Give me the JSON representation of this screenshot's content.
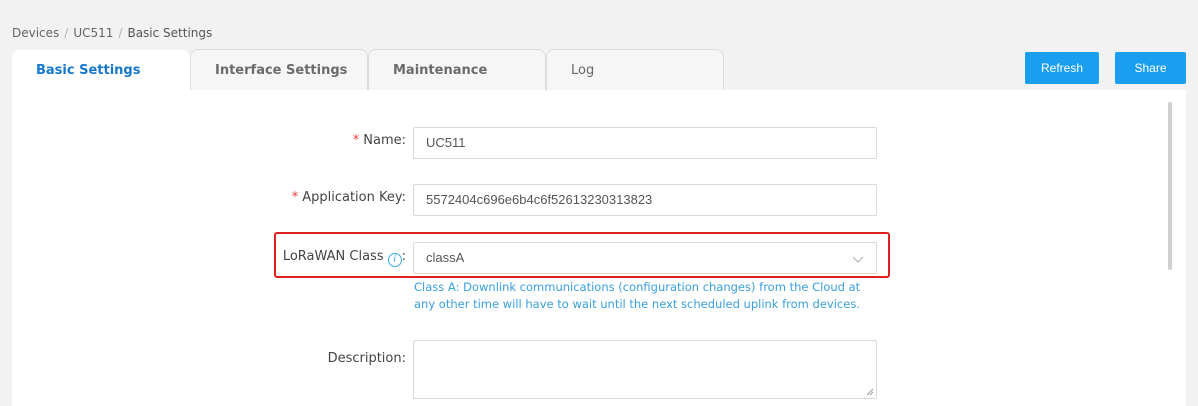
{
  "breadcrumb": {
    "items": [
      "Devices",
      "UC511",
      "Basic Settings"
    ],
    "separator": "/"
  },
  "tabs": [
    {
      "label": "Basic Settings",
      "active": true
    },
    {
      "label": "Interface Settings",
      "active": false
    },
    {
      "label": "Maintenance",
      "active": false
    },
    {
      "label": "Log",
      "active": false
    }
  ],
  "toolbar": {
    "refresh_label": "Refresh",
    "share_label": "Share"
  },
  "form": {
    "name": {
      "label": "Name",
      "required_mark": "*",
      "colon": ":",
      "value": "UC511"
    },
    "application_key": {
      "label": "Application Key",
      "required_mark": "*",
      "colon": ":",
      "value": "5572404c696e6b4c6f52613230313823"
    },
    "lorawan_class": {
      "label": "LoRaWAN Class",
      "info_glyph": "i",
      "colon": ":",
      "selected": "classA",
      "helper_text": "Class A: Downlink communications (configuration changes) from the Cloud at any other time will have to wait until the next scheduled uplink from devices."
    },
    "description": {
      "label": "Description",
      "colon": ":",
      "value": ""
    }
  },
  "colors": {
    "accent": "#1a9ef0",
    "active_tab_text": "#1677cc",
    "required": "#e8423f",
    "helper_text": "#3a9fe0",
    "highlight": "#e02020"
  },
  "icons": {
    "select_arrow": "chevron-down-icon",
    "info": "info-icon",
    "resize": "resize-grip-icon"
  }
}
